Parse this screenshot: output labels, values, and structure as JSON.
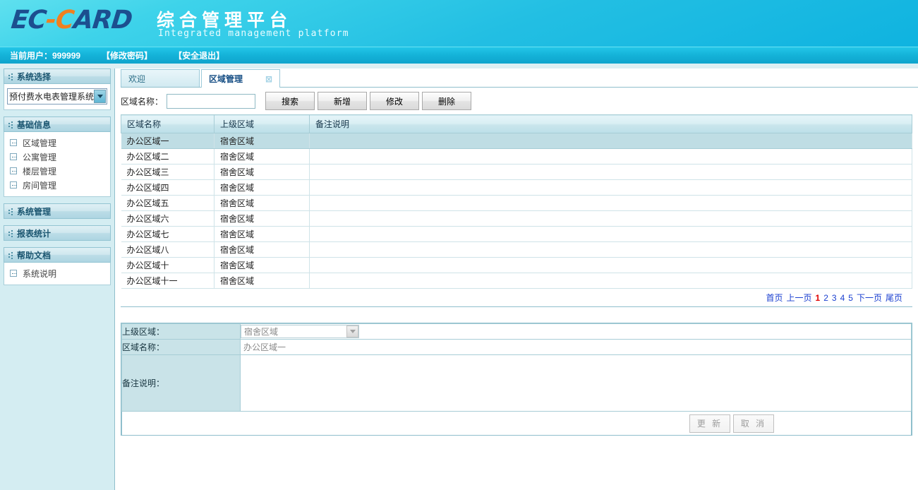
{
  "header": {
    "logo_part1": "EC",
    "logo_part2": "-C",
    "logo_part3": "ARD",
    "brand_cn": "综合管理平台",
    "brand_en": "Integrated management platform",
    "accent_dark": "#1c4f8f",
    "accent_orange": "#f08020"
  },
  "userbar": {
    "current_user_label": "当前用户：999999",
    "change_password": "【修改密码】",
    "safe_exit": "【安全退出】"
  },
  "sidebar": {
    "panels": [
      {
        "title": "系统选择",
        "type": "select",
        "selected": "预付费水电表管理系统"
      },
      {
        "title": "基础信息",
        "type": "menu",
        "items": [
          "区域管理",
          "公寓管理",
          "楼层管理",
          "房间管理"
        ]
      },
      {
        "title": "系统管理",
        "type": "header-only",
        "items": []
      },
      {
        "title": "报表统计",
        "type": "header-only",
        "items": []
      },
      {
        "title": "帮助文档",
        "type": "menu",
        "items": [
          "系统说明"
        ]
      }
    ]
  },
  "tabs": [
    {
      "label": "欢迎",
      "active": false,
      "closable": false
    },
    {
      "label": "区域管理",
      "active": true,
      "closable": true,
      "close_icon": "⊠"
    }
  ],
  "toolbar": {
    "search_label": "区域名称：",
    "search_value": "",
    "search_placeholder": "",
    "buttons": [
      "搜索",
      "新增",
      "修改",
      "删除"
    ]
  },
  "grid": {
    "columns": [
      "区域名称",
      "上级区域",
      "备注说明"
    ],
    "rows": [
      {
        "name": "办公区域一",
        "parent": "宿舍区域",
        "memo": "",
        "selected": true
      },
      {
        "name": "办公区域二",
        "parent": "宿舍区域",
        "memo": "",
        "selected": false
      },
      {
        "name": "办公区域三",
        "parent": "宿舍区域",
        "memo": "",
        "selected": false
      },
      {
        "name": "办公区域四",
        "parent": "宿舍区域",
        "memo": "",
        "selected": false
      },
      {
        "name": "办公区域五",
        "parent": "宿舍区域",
        "memo": "",
        "selected": false
      },
      {
        "name": "办公区域六",
        "parent": "宿舍区域",
        "memo": "",
        "selected": false
      },
      {
        "name": "办公区域七",
        "parent": "宿舍区域",
        "memo": "",
        "selected": false
      },
      {
        "name": "办公区域八",
        "parent": "宿舍区域",
        "memo": "",
        "selected": false
      },
      {
        "name": "办公区域十",
        "parent": "宿舍区域",
        "memo": "",
        "selected": false
      },
      {
        "name": "办公区域十一",
        "parent": "宿舍区域",
        "memo": "",
        "selected": false
      }
    ]
  },
  "pager": {
    "first": "首页",
    "prev": "上一页",
    "pages": [
      "1",
      "2",
      "3",
      "4",
      "5"
    ],
    "current": "1",
    "next": "下一页",
    "last": "尾页",
    "current_color": "#e00000",
    "link_color": "#1a3fd0"
  },
  "form": {
    "parent_label": "上级区域：",
    "parent_value": "宿舍区域",
    "name_label": "区域名称：",
    "name_value": "办公区域一",
    "memo_label": "备注说明：",
    "memo_value": "",
    "update_button": "更 新",
    "cancel_button": "取 消"
  }
}
